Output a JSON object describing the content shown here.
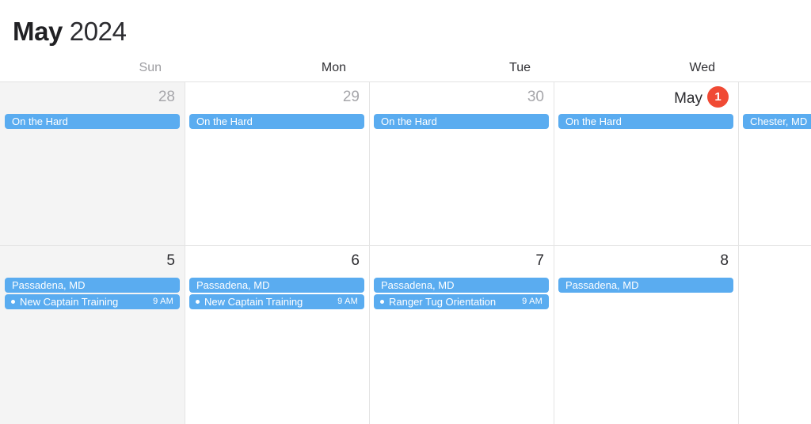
{
  "header": {
    "month": "May",
    "year": "2024"
  },
  "weekdays": [
    {
      "label": "Sun",
      "weekend": true
    },
    {
      "label": "Mon",
      "weekend": false
    },
    {
      "label": "Tue",
      "weekend": false
    },
    {
      "label": "Wed",
      "weekend": false
    },
    {
      "label": "",
      "weekend": false
    }
  ],
  "colors": {
    "event_blue": "#5aacf0",
    "today_red": "#f04a34",
    "weekend_bg": "#f4f4f4",
    "grid_line": "#e4e4e4",
    "text_primary": "#2b2b2f",
    "text_muted": "#a6a6aa"
  },
  "weeks": [
    {
      "days": [
        {
          "number": "28",
          "month_prefix": "",
          "is_today": false,
          "other_month": true,
          "weekend": true,
          "events": [
            {
              "title": "On the Hard",
              "time": "",
              "bullet": false
            }
          ]
        },
        {
          "number": "29",
          "month_prefix": "",
          "is_today": false,
          "other_month": true,
          "weekend": false,
          "events": [
            {
              "title": "On the Hard",
              "time": "",
              "bullet": false
            }
          ]
        },
        {
          "number": "30",
          "month_prefix": "",
          "is_today": false,
          "other_month": true,
          "weekend": false,
          "events": [
            {
              "title": "On the Hard",
              "time": "",
              "bullet": false
            }
          ]
        },
        {
          "number": "1",
          "month_prefix": "May",
          "is_today": true,
          "other_month": false,
          "weekend": false,
          "events": [
            {
              "title": "On the Hard",
              "time": "",
              "bullet": false
            }
          ]
        },
        {
          "number": "",
          "month_prefix": "",
          "is_today": false,
          "other_month": false,
          "weekend": false,
          "events": [
            {
              "title": "Chester, MD",
              "time": "",
              "bullet": false
            }
          ]
        }
      ]
    },
    {
      "days": [
        {
          "number": "5",
          "month_prefix": "",
          "is_today": false,
          "other_month": false,
          "weekend": true,
          "events": [
            {
              "title": "Passadena, MD",
              "time": "",
              "bullet": false
            },
            {
              "title": "New Captain Training",
              "time": "9 AM",
              "bullet": true
            }
          ]
        },
        {
          "number": "6",
          "month_prefix": "",
          "is_today": false,
          "other_month": false,
          "weekend": false,
          "events": [
            {
              "title": "Passadena, MD",
              "time": "",
              "bullet": false
            },
            {
              "title": "New Captain Training",
              "time": "9 AM",
              "bullet": true
            }
          ]
        },
        {
          "number": "7",
          "month_prefix": "",
          "is_today": false,
          "other_month": false,
          "weekend": false,
          "events": [
            {
              "title": "Passadena, MD",
              "time": "",
              "bullet": false
            },
            {
              "title": "Ranger Tug Orientation",
              "time": "9 AM",
              "bullet": true
            }
          ]
        },
        {
          "number": "8",
          "month_prefix": "",
          "is_today": false,
          "other_month": false,
          "weekend": false,
          "events": [
            {
              "title": "Passadena, MD",
              "time": "",
              "bullet": false
            }
          ]
        },
        {
          "number": "",
          "month_prefix": "",
          "is_today": false,
          "other_month": false,
          "weekend": false,
          "events": []
        }
      ]
    }
  ]
}
